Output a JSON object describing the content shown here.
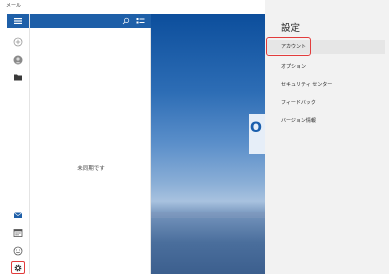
{
  "window": {
    "app_title": "メール",
    "minimize": "–",
    "maximize": "▫",
    "close": "×"
  },
  "rail": {
    "icons": [
      "hamburger-menu-icon",
      "compose-icon",
      "account-icon",
      "folder-icon",
      "mail-icon",
      "calendar-icon",
      "emoji-icon",
      "gear-icon"
    ]
  },
  "list": {
    "empty_message": "未同期です"
  },
  "settings": {
    "title": "設定",
    "items": [
      {
        "label": "アカウント",
        "selected": true
      },
      {
        "label": "オプション",
        "selected": false
      },
      {
        "label": "セキュリティ センター",
        "selected": false
      },
      {
        "label": "フィードバック",
        "selected": false
      },
      {
        "label": "バージョン情報",
        "selected": false
      }
    ]
  },
  "colors": {
    "accent": "#1e5fa8",
    "highlight": "#e23c3c",
    "settings_bg": "#f2f2f2"
  }
}
